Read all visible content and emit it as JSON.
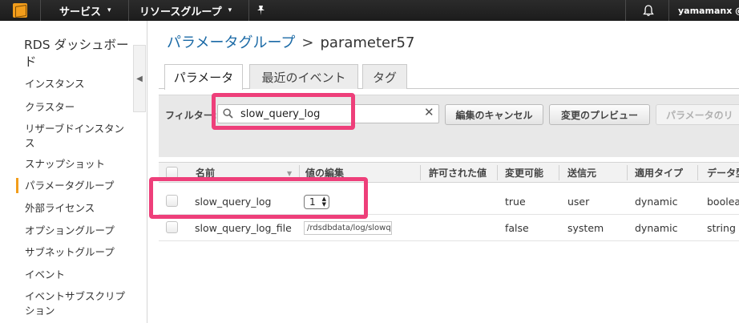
{
  "topbar": {
    "services_label": "サービス",
    "resource_groups_label": "リソースグループ",
    "user_label": "yamamanx @"
  },
  "sidebar": {
    "title": "RDS ダッシュボード",
    "items": [
      {
        "label": "インスタンス"
      },
      {
        "label": "クラスター"
      },
      {
        "label": "リザーブドインスタンス"
      },
      {
        "label": "スナップショット"
      },
      {
        "label": "パラメータグループ",
        "active": true
      },
      {
        "label": "外部ライセンス"
      },
      {
        "label": "オプショングループ"
      },
      {
        "label": "サブネットグループ"
      },
      {
        "label": "イベント"
      },
      {
        "label": "イベントサブスクリプション"
      }
    ]
  },
  "breadcrumb": {
    "parent": "パラメータグループ",
    "separator": ">",
    "current": "parameter57"
  },
  "tabs": [
    {
      "label": "パラメータ",
      "active": true
    },
    {
      "label": "最近のイベント",
      "active": false
    },
    {
      "label": "タグ",
      "active": false
    }
  ],
  "filter": {
    "label": "フィルター:",
    "value": "slow_query_log",
    "clear_glyph": "✕"
  },
  "buttons": {
    "cancel_edit": "編集のキャンセル",
    "preview_changes": "変更のプレビュー",
    "reset_params": "パラメータのリ"
  },
  "table": {
    "columns": [
      "名前",
      "値の編集",
      "許可された値",
      "変更可能",
      "送信元",
      "適用タイプ",
      "データ型"
    ],
    "rows": [
      {
        "name": "slow_query_log",
        "edit_value": "1",
        "allowed_values": "",
        "modifiable": "true",
        "source": "user",
        "apply_type": "dynamic",
        "data_type": "boolean"
      },
      {
        "name": "slow_query_log_file",
        "edit_value": "/rdsdbdata/log/slowquery",
        "allowed_values": "",
        "modifiable": "false",
        "source": "system",
        "apply_type": "dynamic",
        "data_type": "string"
      }
    ]
  },
  "colors": {
    "highlight": "#ee3f7a",
    "link": "#1b6aa6",
    "active_accent": "#f29d1b",
    "topbar": "#1c1c1c"
  }
}
